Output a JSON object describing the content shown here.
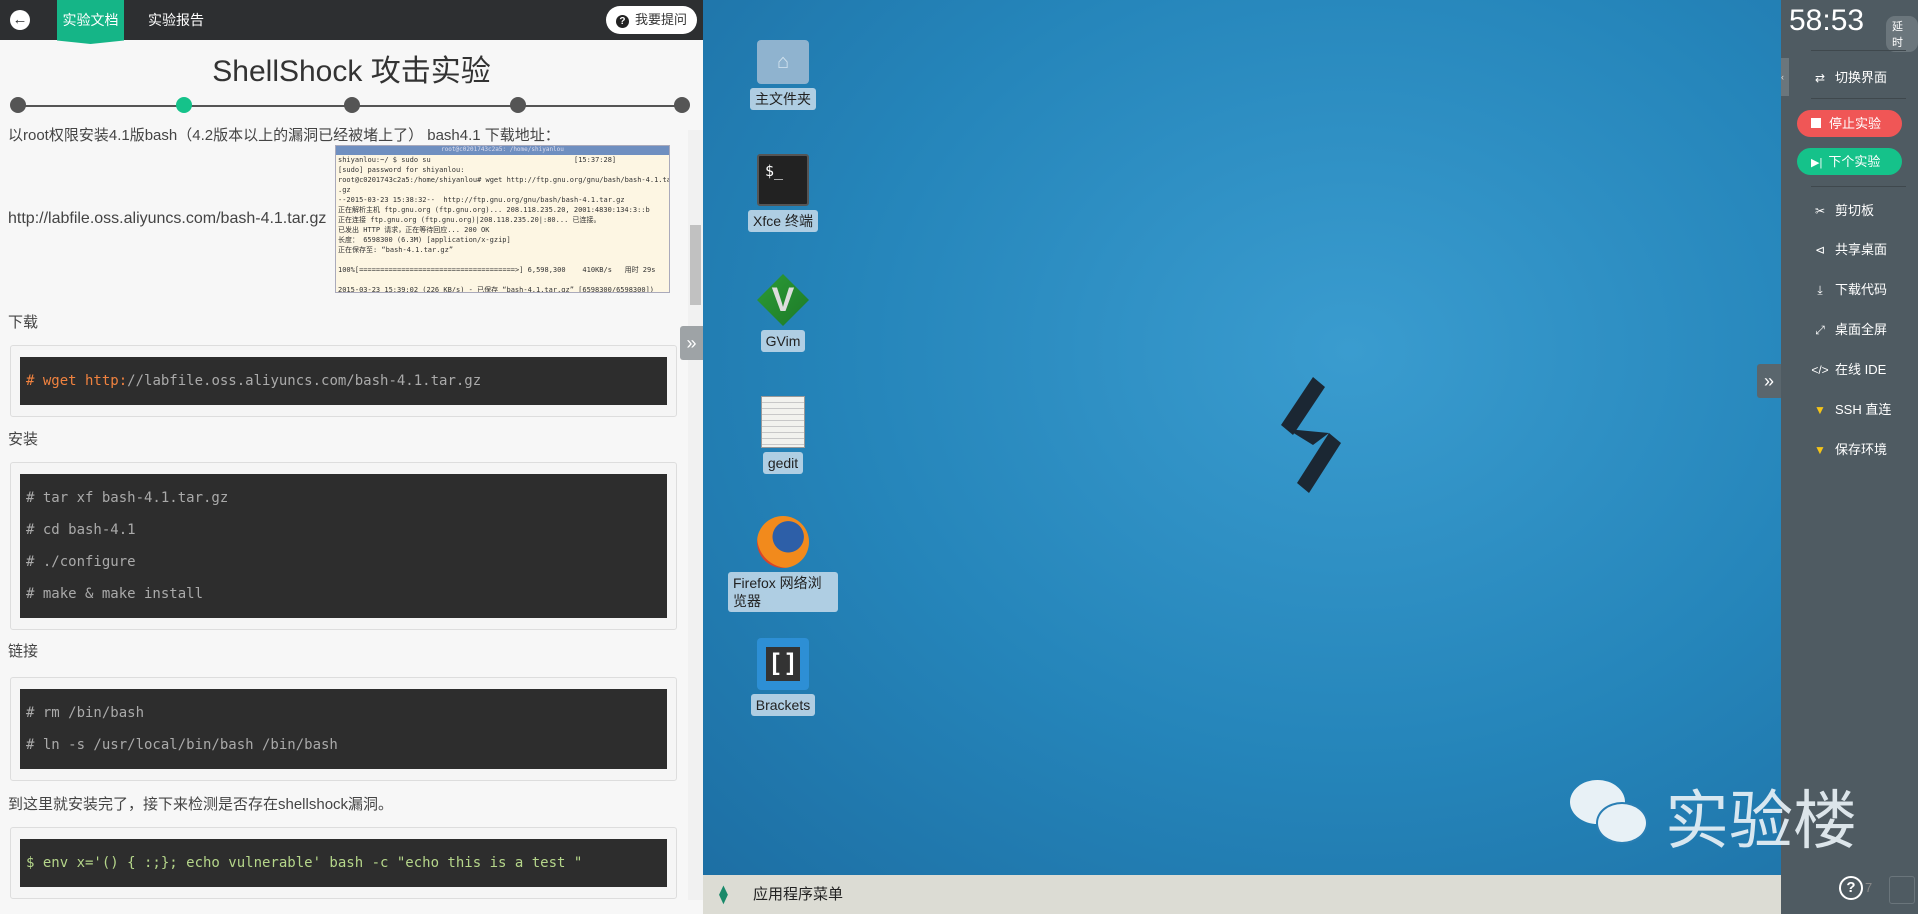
{
  "topbar": {
    "tabs": [
      {
        "label": "实验文档",
        "active": true
      },
      {
        "label": "实验报告",
        "active": false
      }
    ],
    "ask_label": "我要提问"
  },
  "doc": {
    "title": "ShellShock 攻击实验",
    "steps": {
      "count": 5,
      "current": 2
    },
    "intro": "以root权限安装4.1版bash（4.2版本以上的漏洞已经被堵上了） bash4.1 下载地址：",
    "url": "http://labfile.oss.aliyuncs.com/bash-4.1.tar.gz",
    "screenshot": {
      "title": "root@c0201743c2a5: /home/shiyanlou",
      "lines": [
        "shiyanlou:~/ $ sudo su                                  [15:37:28]",
        "[sudo] password for shiyanlou:",
        "root@c0201743c2a5:/home/shiyanlou# wget http://ftp.gnu.org/gnu/bash/bash-4.1.tar",
        ".gz",
        "--2015-03-23 15:38:32--  http://ftp.gnu.org/gnu/bash/bash-4.1.tar.gz",
        "正在解析主机 ftp.gnu.org (ftp.gnu.org)... 208.118.235.20, 2001:4830:134:3::b",
        "正在连接 ftp.gnu.org (ftp.gnu.org)|208.118.235.20|:80... 已连接。",
        "已发出 HTTP 请求，正在等待回应... 200 OK",
        "长度： 6598300 (6.3M) [application/x-gzip]",
        "正在保存至: “bash-4.1.tar.gz”",
        "",
        "100%[=====================================>] 6,598,300    410KB/s   用时 29s",
        "",
        "2015-03-23 15:39:02 (226 KB/s) - 已保存 “bash-4.1.tar.gz” [6598300/6598300])",
        "",
        "root@c0201743c2a5:/home/shiyanlou#"
      ]
    },
    "sections": [
      {
        "heading": "下载",
        "code": [
          "# wget http://labfile.oss.aliyuncs.com/bash-4.1.tar.gz"
        ]
      },
      {
        "heading": "安装",
        "code": [
          "# tar xf bash-4.1.tar.gz",
          "# cd bash-4.1",
          "# ./configure",
          "# make & make install"
        ]
      },
      {
        "heading": "链接",
        "code": [
          "# rm /bin/bash",
          "# ln -s /usr/local/bin/bash /bin/bash"
        ]
      },
      {
        "heading": "到这里就安装完了，接下来检测是否存在shellshock漏洞。",
        "code": [
          "$ env x='() { :;}; echo vulnerable' bash -c \"echo this is a test \""
        ]
      }
    ]
  },
  "desktop": {
    "icons": [
      {
        "label": "主文件夹",
        "icon": "folder-home-icon"
      },
      {
        "label": "Xfce 终端",
        "icon": "terminal-icon"
      },
      {
        "label": "GVim",
        "icon": "vim-icon"
      },
      {
        "label": "gedit",
        "icon": "gedit-icon"
      },
      {
        "label": "Firefox 网络浏览器",
        "icon": "firefox-icon"
      },
      {
        "label": "Brackets",
        "icon": "brackets-icon"
      }
    ],
    "taskbar_menu": "应用程序菜单",
    "watermark": "实验楼"
  },
  "sidebar": {
    "timer": "58:53",
    "delay_label": "延时",
    "switch_label": "切换界面",
    "stop_label": "停止实验",
    "next_label": "下个实验",
    "items": [
      {
        "label": "剪切板",
        "icon": "scissors-icon"
      },
      {
        "label": "共享桌面",
        "icon": "share-icon"
      },
      {
        "label": "下载代码",
        "icon": "download-icon"
      },
      {
        "label": "桌面全屏",
        "icon": "fullscreen-icon"
      },
      {
        "label": "在线 IDE",
        "icon": "code-icon"
      },
      {
        "label": "SSH 直连",
        "icon": "vip-icon"
      },
      {
        "label": "保存环境",
        "icon": "vip-icon"
      }
    ],
    "help_count": "7"
  },
  "colors": {
    "accent": "#15b587",
    "stop": "#f05656",
    "next": "#15c28a",
    "sidebar": "#4f5b62",
    "vip": "#f5c518"
  }
}
